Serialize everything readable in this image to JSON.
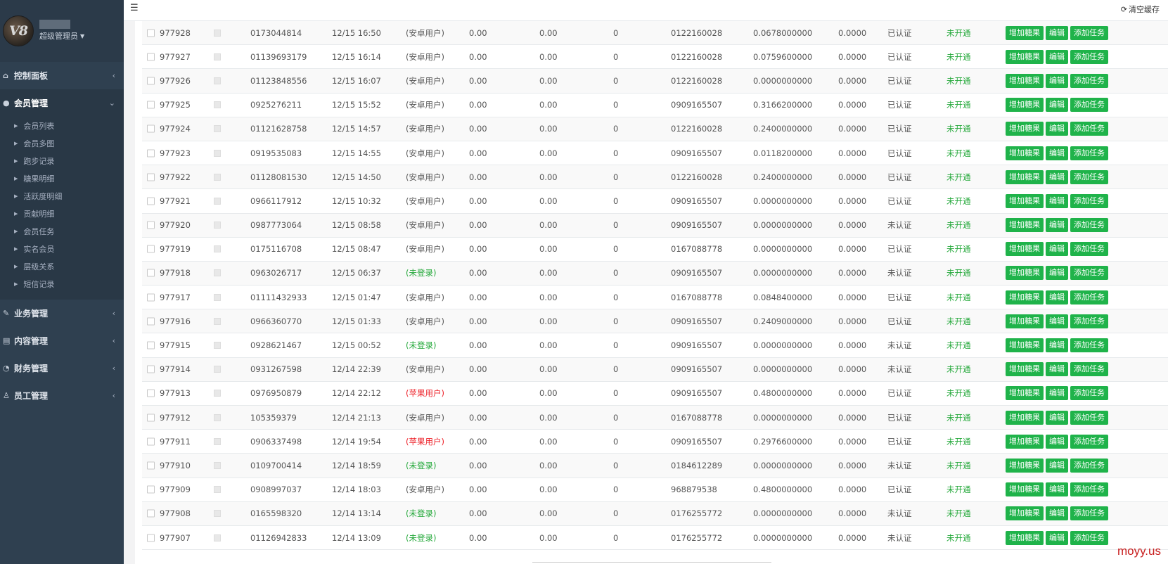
{
  "sidebar": {
    "logo_text": "V8",
    "role": "超级管理员",
    "menu": [
      {
        "label": "控制面板",
        "icon": "home-icon",
        "arrow": "‹"
      },
      {
        "label": "会员管理",
        "icon": "user-icon",
        "arrow": "⌄",
        "active": true
      },
      {
        "label": "业务管理",
        "icon": "edit-icon",
        "arrow": "‹"
      },
      {
        "label": "内容管理",
        "icon": "book-icon",
        "arrow": "‹"
      },
      {
        "label": "财务管理",
        "icon": "pie-icon",
        "arrow": "‹"
      },
      {
        "label": "员工管理",
        "icon": "sitemap-icon",
        "arrow": "‹"
      }
    ],
    "submenu": [
      "会员列表",
      "会员多图",
      "跑步记录",
      "糖果明细",
      "活跃度明细",
      "贡献明细",
      "会员任务",
      "实名会员",
      "层级关系",
      "短信记录"
    ]
  },
  "topbar": {
    "clear_cache": "清空缓存"
  },
  "buttons": {
    "add_candy": "增加糖果",
    "edit": "编辑",
    "add_task": "添加任务"
  },
  "rows": [
    {
      "id": "977928",
      "phone": "0173044814",
      "time": "12/15 16:50",
      "type": "(安卓用户)",
      "type_kind": "android",
      "a": "0.00",
      "b": "0.00",
      "c": "0",
      "ref": "0122160028",
      "balance": "0.0678000000",
      "d": "0.0000",
      "verified": "已认证",
      "open": "未开通"
    },
    {
      "id": "977927",
      "phone": "01139693179",
      "time": "12/15 16:14",
      "type": "(安卓用户)",
      "type_kind": "android",
      "a": "0.00",
      "b": "0.00",
      "c": "0",
      "ref": "0122160028",
      "balance": "0.0759600000",
      "d": "0.0000",
      "verified": "已认证",
      "open": "未开通"
    },
    {
      "id": "977926",
      "phone": "01123848556",
      "time": "12/15 16:07",
      "type": "(安卓用户)",
      "type_kind": "android",
      "a": "0.00",
      "b": "0.00",
      "c": "0",
      "ref": "0122160028",
      "balance": "0.0000000000",
      "d": "0.0000",
      "verified": "已认证",
      "open": "未开通"
    },
    {
      "id": "977925",
      "phone": "0925276211",
      "time": "12/15 15:52",
      "type": "(安卓用户)",
      "type_kind": "android",
      "a": "0.00",
      "b": "0.00",
      "c": "0",
      "ref": "0909165507",
      "balance": "0.3166200000",
      "d": "0.0000",
      "verified": "已认证",
      "open": "未开通"
    },
    {
      "id": "977924",
      "phone": "01121628758",
      "time": "12/15 14:57",
      "type": "(安卓用户)",
      "type_kind": "android",
      "a": "0.00",
      "b": "0.00",
      "c": "0",
      "ref": "0122160028",
      "balance": "0.2400000000",
      "d": "0.0000",
      "verified": "已认证",
      "open": "未开通"
    },
    {
      "id": "977923",
      "phone": "0919535083",
      "time": "12/15 14:55",
      "type": "(安卓用户)",
      "type_kind": "android",
      "a": "0.00",
      "b": "0.00",
      "c": "0",
      "ref": "0909165507",
      "balance": "0.0118200000",
      "d": "0.0000",
      "verified": "已认证",
      "open": "未开通"
    },
    {
      "id": "977922",
      "phone": "01128081530",
      "time": "12/15 14:50",
      "type": "(安卓用户)",
      "type_kind": "android",
      "a": "0.00",
      "b": "0.00",
      "c": "0",
      "ref": "0122160028",
      "balance": "0.2400000000",
      "d": "0.0000",
      "verified": "已认证",
      "open": "未开通"
    },
    {
      "id": "977921",
      "phone": "0966117912",
      "time": "12/15 10:32",
      "type": "(安卓用户)",
      "type_kind": "android",
      "a": "0.00",
      "b": "0.00",
      "c": "0",
      "ref": "0909165507",
      "balance": "0.0000000000",
      "d": "0.0000",
      "verified": "已认证",
      "open": "未开通"
    },
    {
      "id": "977920",
      "phone": "0987773064",
      "time": "12/15 08:58",
      "type": "(安卓用户)",
      "type_kind": "android",
      "a": "0.00",
      "b": "0.00",
      "c": "0",
      "ref": "0909165507",
      "balance": "0.0000000000",
      "d": "0.0000",
      "verified": "未认证",
      "open": "未开通"
    },
    {
      "id": "977919",
      "phone": "0175116708",
      "time": "12/15 08:47",
      "type": "(安卓用户)",
      "type_kind": "android",
      "a": "0.00",
      "b": "0.00",
      "c": "0",
      "ref": "0167088778",
      "balance": "0.0000000000",
      "d": "0.0000",
      "verified": "已认证",
      "open": "未开通"
    },
    {
      "id": "977918",
      "phone": "0963026717",
      "time": "12/15 06:37",
      "type": "(未登录)",
      "type_kind": "unlogged",
      "a": "0.00",
      "b": "0.00",
      "c": "0",
      "ref": "0909165507",
      "balance": "0.0000000000",
      "d": "0.0000",
      "verified": "未认证",
      "open": "未开通"
    },
    {
      "id": "977917",
      "phone": "01111432933",
      "time": "12/15 01:47",
      "type": "(安卓用户)",
      "type_kind": "android",
      "a": "0.00",
      "b": "0.00",
      "c": "0",
      "ref": "0167088778",
      "balance": "0.0848400000",
      "d": "0.0000",
      "verified": "已认证",
      "open": "未开通"
    },
    {
      "id": "977916",
      "phone": "0966360770",
      "time": "12/15 01:33",
      "type": "(安卓用户)",
      "type_kind": "android",
      "a": "0.00",
      "b": "0.00",
      "c": "0",
      "ref": "0909165507",
      "balance": "0.2409000000",
      "d": "0.0000",
      "verified": "已认证",
      "open": "未开通"
    },
    {
      "id": "977915",
      "phone": "0928621467",
      "time": "12/15 00:52",
      "type": "(未登录)",
      "type_kind": "unlogged",
      "a": "0.00",
      "b": "0.00",
      "c": "0",
      "ref": "0909165507",
      "balance": "0.0000000000",
      "d": "0.0000",
      "verified": "未认证",
      "open": "未开通"
    },
    {
      "id": "977914",
      "phone": "0931267598",
      "time": "12/14 22:39",
      "type": "(安卓用户)",
      "type_kind": "android",
      "a": "0.00",
      "b": "0.00",
      "c": "0",
      "ref": "0909165507",
      "balance": "0.0000000000",
      "d": "0.0000",
      "verified": "未认证",
      "open": "未开通"
    },
    {
      "id": "977913",
      "phone": "0976950879",
      "time": "12/14 22:12",
      "type": "(苹果用户)",
      "type_kind": "apple",
      "a": "0.00",
      "b": "0.00",
      "c": "0",
      "ref": "0909165507",
      "balance": "0.4800000000",
      "d": "0.0000",
      "verified": "已认证",
      "open": "未开通"
    },
    {
      "id": "977912",
      "phone": "105359379",
      "time": "12/14 21:13",
      "type": "(安卓用户)",
      "type_kind": "android",
      "a": "0.00",
      "b": "0.00",
      "c": "0",
      "ref": "0167088778",
      "balance": "0.0000000000",
      "d": "0.0000",
      "verified": "已认证",
      "open": "未开通"
    },
    {
      "id": "977911",
      "phone": "0906337498",
      "time": "12/14 19:54",
      "type": "(苹果用户)",
      "type_kind": "apple",
      "a": "0.00",
      "b": "0.00",
      "c": "0",
      "ref": "0909165507",
      "balance": "0.2976600000",
      "d": "0.0000",
      "verified": "已认证",
      "open": "未开通"
    },
    {
      "id": "977910",
      "phone": "0109700414",
      "time": "12/14 18:59",
      "type": "(未登录)",
      "type_kind": "unlogged",
      "a": "0.00",
      "b": "0.00",
      "c": "0",
      "ref": "0184612289",
      "balance": "0.0000000000",
      "d": "0.0000",
      "verified": "未认证",
      "open": "未开通"
    },
    {
      "id": "977909",
      "phone": "0908997037",
      "time": "12/14 18:03",
      "type": "(安卓用户)",
      "type_kind": "android",
      "a": "0.00",
      "b": "0.00",
      "c": "0",
      "ref": "968879538",
      "balance": "0.4800000000",
      "d": "0.0000",
      "verified": "已认证",
      "open": "未开通"
    },
    {
      "id": "977908",
      "phone": "0165598320",
      "time": "12/14 13:14",
      "type": "(未登录)",
      "type_kind": "unlogged",
      "a": "0.00",
      "b": "0.00",
      "c": "0",
      "ref": "0176255772",
      "balance": "0.0000000000",
      "d": "0.0000",
      "verified": "未认证",
      "open": "未开通"
    },
    {
      "id": "977907",
      "phone": "01126942833",
      "time": "12/14 13:09",
      "type": "(未登录)",
      "type_kind": "unlogged",
      "a": "0.00",
      "b": "0.00",
      "c": "0",
      "ref": "0176255772",
      "balance": "0.0000000000",
      "d": "0.0000",
      "verified": "未认证",
      "open": "未开通"
    }
  ],
  "watermark": "moyy.us"
}
